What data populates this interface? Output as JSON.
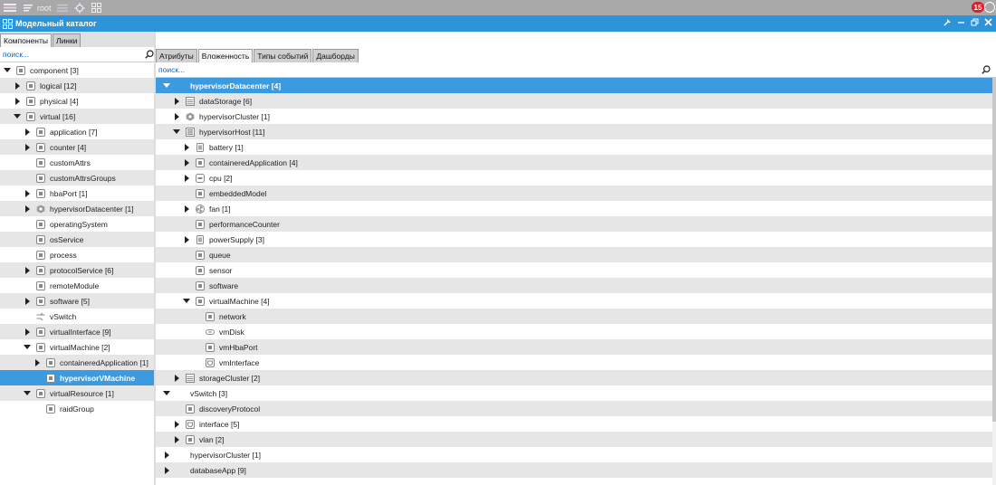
{
  "topbar": {
    "user": "root",
    "notifications": "15",
    "icons": [
      "app-menu-icon",
      "list-icon",
      "user-icon",
      "list-icon",
      "target-icon",
      "grid-icon",
      "alert-icon"
    ]
  },
  "window": {
    "title": "Модельный каталог",
    "controls": [
      "pin-icon",
      "minimize-icon",
      "restore-icon",
      "close-icon"
    ]
  },
  "left_panel": {
    "tabs": [
      {
        "label": "Компоненты",
        "active": true
      },
      {
        "label": "Линки",
        "active": false
      }
    ],
    "search_placeholder": "поиск...",
    "tree": [
      {
        "label": "component [3]",
        "level": 0,
        "toggle": "down",
        "icon": "box",
        "zebra": false
      },
      {
        "label": "logical [12]",
        "level": 1,
        "toggle": "right",
        "icon": "box",
        "zebra": true
      },
      {
        "label": "physical [4]",
        "level": 1,
        "toggle": "right",
        "icon": "box",
        "zebra": false
      },
      {
        "label": "virtual [16]",
        "level": 1,
        "toggle": "down",
        "icon": "box",
        "zebra": true
      },
      {
        "label": "application [7]",
        "level": 2,
        "toggle": "right",
        "icon": "box",
        "zebra": false
      },
      {
        "label": "counter [4]",
        "level": 2,
        "toggle": "right",
        "icon": "box",
        "zebra": true
      },
      {
        "label": "customAttrs",
        "level": 2,
        "toggle": "none",
        "icon": "box",
        "zebra": false
      },
      {
        "label": "customAttrsGroups",
        "level": 2,
        "toggle": "none",
        "icon": "box",
        "zebra": true
      },
      {
        "label": "hbaPort [1]",
        "level": 2,
        "toggle": "right",
        "icon": "box",
        "zebra": false
      },
      {
        "label": "hypervisorDatacenter [1]",
        "level": 2,
        "toggle": "right",
        "icon": "hex",
        "zebra": true
      },
      {
        "label": "operatingSystem",
        "level": 2,
        "toggle": "none",
        "icon": "box",
        "zebra": false
      },
      {
        "label": "osService",
        "level": 2,
        "toggle": "none",
        "icon": "box",
        "zebra": true
      },
      {
        "label": "process",
        "level": 2,
        "toggle": "none",
        "icon": "box",
        "zebra": false
      },
      {
        "label": "protocolService [6]",
        "level": 2,
        "toggle": "right",
        "icon": "box",
        "zebra": true
      },
      {
        "label": "remoteModule",
        "level": 2,
        "toggle": "none",
        "icon": "box",
        "zebra": false
      },
      {
        "label": "software [5]",
        "level": 2,
        "toggle": "right",
        "icon": "box",
        "zebra": true
      },
      {
        "label": "vSwitch",
        "level": 2,
        "toggle": "none",
        "icon": "switch",
        "zebra": false
      },
      {
        "label": "virtualInterface [9]",
        "level": 2,
        "toggle": "right",
        "icon": "box",
        "zebra": true
      },
      {
        "label": "virtualMachine [2]",
        "level": 2,
        "toggle": "down",
        "icon": "box",
        "zebra": false
      },
      {
        "label": "containeredApplication [1]",
        "level": 3,
        "toggle": "right",
        "icon": "box",
        "zebra": true
      },
      {
        "label": "hypervisorVMachine",
        "level": 3,
        "toggle": "none",
        "icon": "box",
        "zebra": false,
        "selected": true
      },
      {
        "label": "virtualResource [1]",
        "level": 2,
        "toggle": "down",
        "icon": "box",
        "zebra": true
      },
      {
        "label": "raidGroup",
        "level": 3,
        "toggle": "none",
        "icon": "box",
        "zebra": false
      }
    ]
  },
  "right_panel": {
    "tabs": [
      {
        "label": "Атрибуты",
        "active": false
      },
      {
        "label": "Вложенность",
        "active": true
      },
      {
        "label": "Типы событий",
        "active": false
      },
      {
        "label": "Дашборды",
        "active": false
      }
    ],
    "search_placeholder": "поиск...",
    "tree": [
      {
        "label": "hypervisorDatacenter [4]",
        "level": 0,
        "toggle": "down",
        "icon": "none",
        "zebra": false,
        "selected": true
      },
      {
        "label": "dataStorage [6]",
        "level": 1,
        "toggle": "right",
        "icon": "stack",
        "zebra": true
      },
      {
        "label": "hypervisorCluster [1]",
        "level": 1,
        "toggle": "right",
        "icon": "hex",
        "zebra": false
      },
      {
        "label": "hypervisorHost [11]",
        "level": 1,
        "toggle": "down",
        "icon": "server",
        "zebra": true
      },
      {
        "label": "battery [1]",
        "level": 2,
        "toggle": "right",
        "icon": "battery",
        "zebra": false
      },
      {
        "label": "containeredApplication [4]",
        "level": 2,
        "toggle": "right",
        "icon": "box",
        "zebra": true
      },
      {
        "label": "cpu [2]",
        "level": 2,
        "toggle": "right",
        "icon": "chip",
        "zebra": false
      },
      {
        "label": "embeddedModel",
        "level": 2,
        "toggle": "none",
        "icon": "box",
        "zebra": true
      },
      {
        "label": "fan [1]",
        "level": 2,
        "toggle": "right",
        "icon": "fan",
        "zebra": false
      },
      {
        "label": "performanceCounter",
        "level": 2,
        "toggle": "none",
        "icon": "box",
        "zebra": true
      },
      {
        "label": "powerSupply [3]",
        "level": 2,
        "toggle": "right",
        "icon": "battery",
        "zebra": false
      },
      {
        "label": "queue",
        "level": 2,
        "toggle": "none",
        "icon": "box",
        "zebra": true
      },
      {
        "label": "sensor",
        "level": 2,
        "toggle": "none",
        "icon": "box",
        "zebra": false
      },
      {
        "label": "software",
        "level": 2,
        "toggle": "none",
        "icon": "box",
        "zebra": true
      },
      {
        "label": "virtualMachine [4]",
        "level": 2,
        "toggle": "down",
        "icon": "box",
        "zebra": false
      },
      {
        "label": "network",
        "level": 3,
        "toggle": "none",
        "icon": "box",
        "zebra": true
      },
      {
        "label": "vmDisk",
        "level": 3,
        "toggle": "none",
        "icon": "disk",
        "zebra": false
      },
      {
        "label": "vmHbaPort",
        "level": 3,
        "toggle": "none",
        "icon": "box",
        "zebra": true
      },
      {
        "label": "vmInterface",
        "level": 3,
        "toggle": "none",
        "icon": "port",
        "zebra": false
      },
      {
        "label": "storageCluster [2]",
        "level": 1,
        "toggle": "right",
        "icon": "stack",
        "zebra": true
      },
      {
        "label": "vSwitch [3]",
        "level": 0,
        "toggle": "down",
        "icon": "none",
        "zebra": false
      },
      {
        "label": "discoveryProtocol",
        "level": 1,
        "toggle": "none",
        "icon": "box",
        "zebra": true
      },
      {
        "label": "interface [5]",
        "level": 1,
        "toggle": "right",
        "icon": "port",
        "zebra": false
      },
      {
        "label": "vlan [2]",
        "level": 1,
        "toggle": "right",
        "icon": "box",
        "zebra": true
      },
      {
        "label": "hypervisorCluster [1]",
        "level": 0,
        "toggle": "right",
        "icon": "none",
        "zebra": false
      },
      {
        "label": "databaseApp [9]",
        "level": 0,
        "toggle": "right",
        "icon": "none",
        "zebra": true
      }
    ]
  },
  "colors": {
    "accent": "#2e94d9",
    "selected": "#3c9be0",
    "zebra": "#e6e6e6",
    "topbar": "#a9a9a9",
    "badge": "#d8212b"
  }
}
